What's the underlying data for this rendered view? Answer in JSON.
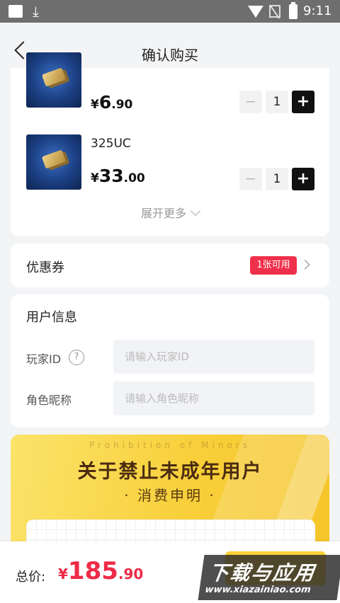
{
  "status_bar": {
    "time": "9:11"
  },
  "header": {
    "title": "确认购买"
  },
  "products": [
    {
      "name": "",
      "price_currency": "¥",
      "price_int": "6",
      "price_dec": ".90",
      "quantity": "1"
    },
    {
      "name": "325UC",
      "price_currency": "¥",
      "price_int": "33",
      "price_dec": ".00",
      "quantity": "1"
    }
  ],
  "stepper": {
    "minus": "−",
    "plus": "+"
  },
  "expand_more": "展开更多",
  "coupon": {
    "label": "优惠券",
    "badge": "1张可用"
  },
  "user_info": {
    "title": "用户信息",
    "player_id_label": "玩家ID",
    "player_id_placeholder": "请输入玩家ID",
    "help": "?",
    "role_name_label": "角色昵称",
    "role_name_placeholder": "请输入角色昵称"
  },
  "banner": {
    "english": "Prohibition of Minors",
    "title": "关于禁止未成年用户",
    "subtitle": "· 消费申明 ·"
  },
  "footer": {
    "total_label": "总价:",
    "total_currency": "¥",
    "total_int": "185",
    "total_dec": ".90"
  },
  "watermark": {
    "line1": "下载与应用",
    "line2": "www.xiazainiao.com"
  },
  "colors": {
    "accent_red": "#ee2b47",
    "badge_red": "#f0304a",
    "banner_yellow": "#f8cf3a"
  }
}
